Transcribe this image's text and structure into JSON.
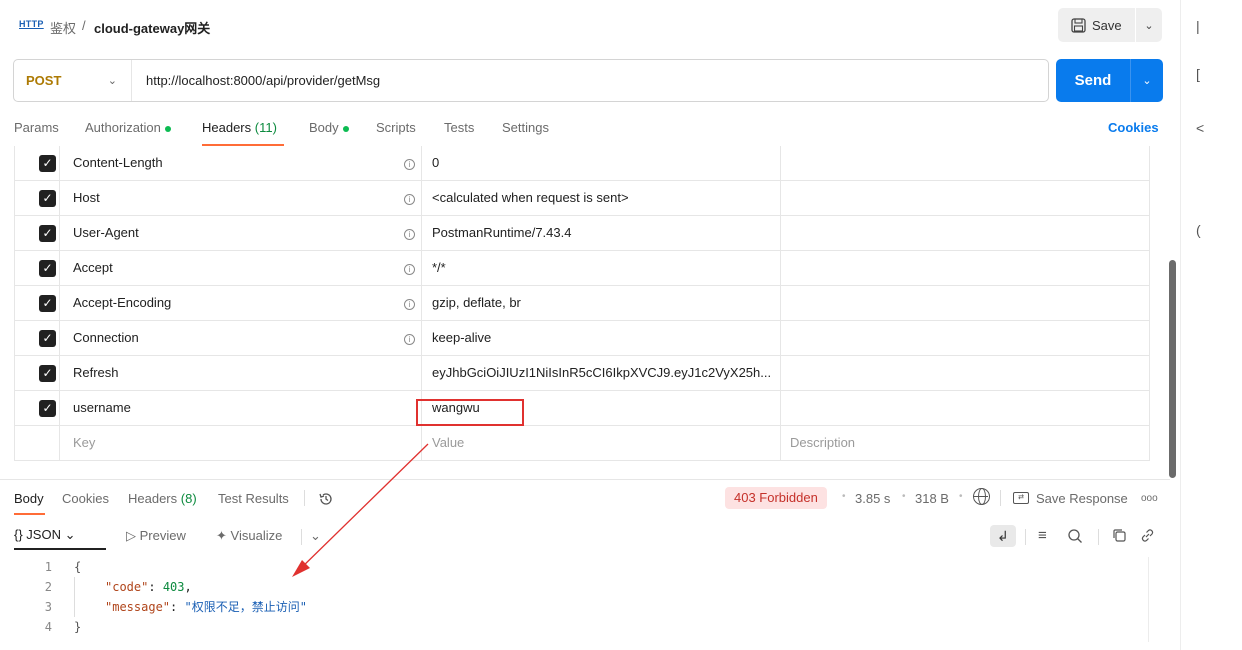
{
  "topbar": {
    "http_icon": "HTTP",
    "breadcrumb_parent": "鉴权",
    "breadcrumb_sep": "/",
    "breadcrumb_current": "cloud-gateway网关",
    "save_label": "Save"
  },
  "request": {
    "method": "POST",
    "url": "http://localhost:8000/api/provider/getMsg",
    "send_label": "Send"
  },
  "request_tabs": {
    "params": "Params",
    "authorization": "Authorization",
    "headers": "Headers",
    "headers_count": "(11)",
    "body": "Body",
    "scripts": "Scripts",
    "tests": "Tests",
    "settings": "Settings",
    "cookies": "Cookies"
  },
  "headers_table": {
    "rows": [
      {
        "key": "Content-Length",
        "value": "0",
        "info": true
      },
      {
        "key": "Host",
        "value": "<calculated when request is sent>",
        "info": true
      },
      {
        "key": "User-Agent",
        "value": "PostmanRuntime/7.43.4",
        "info": true
      },
      {
        "key": "Accept",
        "value": "*/*",
        "info": true
      },
      {
        "key": "Accept-Encoding",
        "value": "gzip, deflate, br",
        "info": true
      },
      {
        "key": "Connection",
        "value": "keep-alive",
        "info": true
      },
      {
        "key": "Refresh",
        "value": "eyJhbGciOiJIUzI1NiIsInR5cCI6IkpXVCJ9.eyJ1c2VyX25h...",
        "info": false
      },
      {
        "key": "username",
        "value": "wangwu",
        "info": false
      }
    ],
    "placeholder_key": "Key",
    "placeholder_value": "Value",
    "placeholder_description": "Description"
  },
  "response_tabs": {
    "body": "Body",
    "cookies": "Cookies",
    "headers": "Headers",
    "headers_count": "(8)",
    "test_results": "Test Results",
    "status": "403 Forbidden",
    "time": "3.85 s",
    "size": "318 B",
    "save_response": "Save Response",
    "more": "ooo"
  },
  "view_bar": {
    "format": "{} JSON",
    "preview": "Preview",
    "visualize": "Visualize"
  },
  "response_body": {
    "line_numbers": [
      "1",
      "2",
      "3",
      "4"
    ],
    "open": "{",
    "code_key": "\"code\"",
    "code_value": "403",
    "message_key": "\"message\"",
    "message_value": "\"权限不足，禁止访问\"",
    "close": "}"
  },
  "sidebar_glyphs": [
    "|",
    "[",
    "<",
    "("
  ],
  "colors": {
    "accent": "#ff6c37",
    "send": "#097bed",
    "method": "#ad7a03",
    "error_badge": "#fde2e2",
    "annotation": "#e0312f"
  }
}
